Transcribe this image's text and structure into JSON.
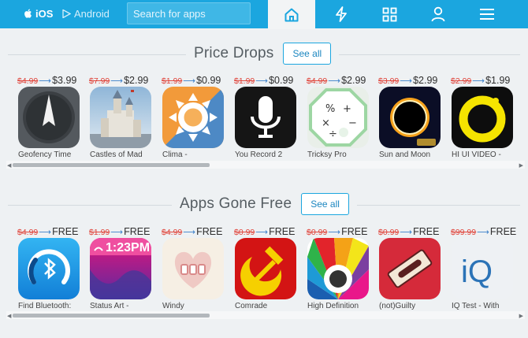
{
  "topbar": {
    "ios_label": "iOS",
    "android_label": "Android",
    "search_placeholder": "Search for apps",
    "nav_icons": [
      "home-icon",
      "bolt-icon",
      "grid-icon",
      "user-icon",
      "menu-icon"
    ],
    "bg_color": "#1ba6df"
  },
  "sections": [
    {
      "title": "Price Drops",
      "see_all": "See all",
      "apps": [
        {
          "old": "$4.99",
          "new": "$3.99",
          "name": "Geofency Time",
          "icon": "compass-icon"
        },
        {
          "old": "$7.99",
          "new": "$2.99",
          "name": "Castles of Mad",
          "icon": "castle-icon"
        },
        {
          "old": "$1.99",
          "new": "$0.99",
          "name": "Clima -",
          "icon": "sun-clock-icon"
        },
        {
          "old": "$1.99",
          "new": "$0.99",
          "name": "You Record 2",
          "icon": "microphone-icon"
        },
        {
          "old": "$4.99",
          "new": "$2.99",
          "name": "Tricksy Pro",
          "icon": "math-operators-icon"
        },
        {
          "old": "$3.99",
          "new": "$2.99",
          "name": "Sun and Moon",
          "icon": "eclipse-icon"
        },
        {
          "old": "$2.99",
          "new": "$1.99",
          "name": "HI UI VIDEO -",
          "icon": "yellow-ring-icon"
        }
      ]
    },
    {
      "title": "Apps Gone Free",
      "see_all": "See all",
      "apps": [
        {
          "old": "$4.99",
          "new": "FREE",
          "name": "Find Bluetooth:",
          "icon": "bluetooth-gauge-icon"
        },
        {
          "old": "$1.99",
          "new": "FREE",
          "name": "Status Art -",
          "icon": "status-bar-icon",
          "overlay": "1:23PM"
        },
        {
          "old": "$4.99",
          "new": "FREE",
          "name": "Windy",
          "icon": "windy-heart-icon"
        },
        {
          "old": "$0.99",
          "new": "FREE",
          "name": "Comrade",
          "icon": "hammer-sickle-icon"
        },
        {
          "old": "$0.99",
          "new": "FREE",
          "name": "High Definition",
          "icon": "color-fan-icon"
        },
        {
          "old": "$0.99",
          "new": "FREE",
          "name": "(not)Guilty",
          "icon": "razor-blade-icon"
        },
        {
          "old": "$99.99",
          "new": "FREE",
          "name": "IQ Test - With",
          "icon": "iq-icon",
          "overlay": "iQ"
        }
      ]
    }
  ]
}
